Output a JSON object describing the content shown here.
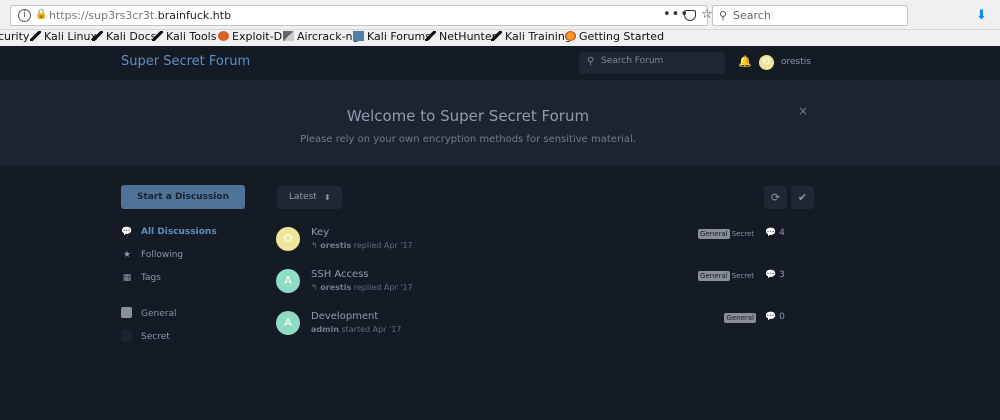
{
  "browser": {
    "url_prefix": "https://sup3rs3cr3t.",
    "url_host": "brainfuck.htb",
    "more_label": "•••",
    "search_placeholder": "Search",
    "bookmarks": [
      "curity",
      "Kali Linux",
      "Kali Docs",
      "Kali Tools",
      "Exploit-DB",
      "Aircrack-ng",
      "Kali Forums",
      "NetHunter",
      "Kali Training",
      "Getting Started"
    ]
  },
  "forum": {
    "title": "Super Secret Forum",
    "search_placeholder": "Search Forum",
    "user": {
      "initial": "O",
      "name": "orestis",
      "avatar_color": "#ece59a"
    }
  },
  "hero": {
    "title": "Welcome to Super Secret Forum",
    "subtitle": "Please rely on your own encryption methods for sensitive material.",
    "close": "×"
  },
  "sidebar": {
    "start_label": "Start a Discussion",
    "nav": [
      {
        "label": "All Discussions",
        "icon": "chat-bubble-icon"
      },
      {
        "label": "Following",
        "icon": "star-icon"
      },
      {
        "label": "Tags",
        "icon": "grid-icon"
      }
    ],
    "tags": [
      {
        "label": "General",
        "color": "#8a8f96"
      },
      {
        "label": "Secret",
        "color": "#1d2430"
      }
    ]
  },
  "toolbar": {
    "sort_label": "Latest",
    "caret": "⬍",
    "refresh": "⟳",
    "mark_read": "✔"
  },
  "discussions": [
    {
      "title": "Key",
      "initial": "O",
      "avatar_color": "#ece59a",
      "user": "orestis",
      "action": "replied Apr '17",
      "tags": [
        "General",
        "Secret"
      ],
      "count": "4",
      "reply_icon": "↰"
    },
    {
      "title": "SSH Access",
      "initial": "A",
      "avatar_color": "#8fdcc4",
      "user": "orestis",
      "action": "replied Apr '17",
      "tags": [
        "General",
        "Secret"
      ],
      "count": "3",
      "reply_icon": "↰"
    },
    {
      "title": "Development",
      "initial": "A",
      "avatar_color": "#8fdcc4",
      "user": "admin",
      "action": "started Apr '17",
      "tags": [
        "General"
      ],
      "count": "0",
      "reply_icon": ""
    }
  ]
}
